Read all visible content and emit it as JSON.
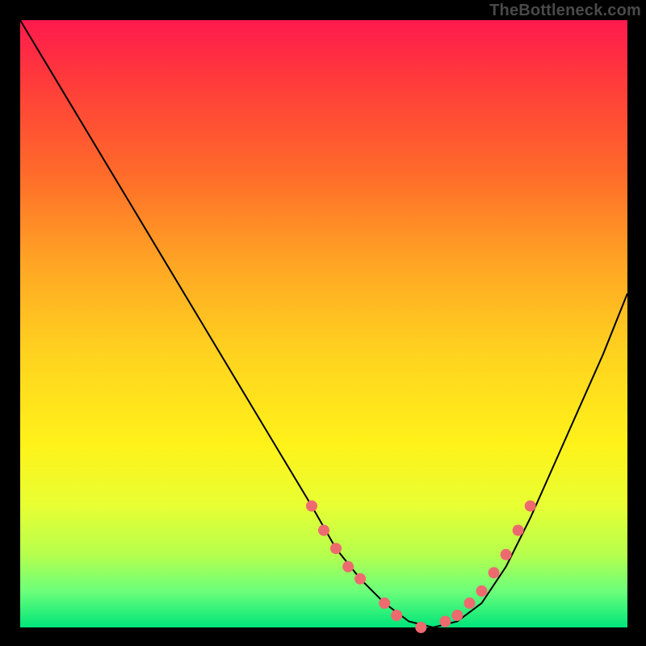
{
  "watermark": "TheBottleneck.com",
  "chart_data": {
    "type": "line",
    "title": "",
    "xlabel": "",
    "ylabel": "",
    "xlim": [
      0,
      100
    ],
    "ylim": [
      0,
      100
    ],
    "series": [
      {
        "name": "bottleneck-curve",
        "x": [
          0,
          6,
          12,
          18,
          24,
          30,
          36,
          42,
          48,
          52,
          56,
          60,
          64,
          68,
          72,
          76,
          80,
          84,
          88,
          92,
          96,
          100
        ],
        "values": [
          100,
          90,
          80,
          70,
          60,
          50,
          40,
          30,
          20,
          13,
          8,
          4,
          1,
          0,
          1,
          4,
          10,
          18,
          27,
          36,
          45,
          55
        ]
      }
    ],
    "markers": {
      "color": "#ed6a6f",
      "radius_px": 7,
      "points_x": [
        48,
        50,
        52,
        54,
        56,
        60,
        62,
        66,
        70,
        72,
        74,
        76,
        78,
        80,
        82,
        84
      ],
      "points_values": [
        20,
        16,
        13,
        10,
        8,
        4,
        2,
        0,
        1,
        2,
        4,
        6,
        9,
        12,
        16,
        20
      ]
    },
    "background_gradient": {
      "top": "#ff1a4d",
      "mid": "#fff21a",
      "bottom": "#00e57a"
    }
  }
}
